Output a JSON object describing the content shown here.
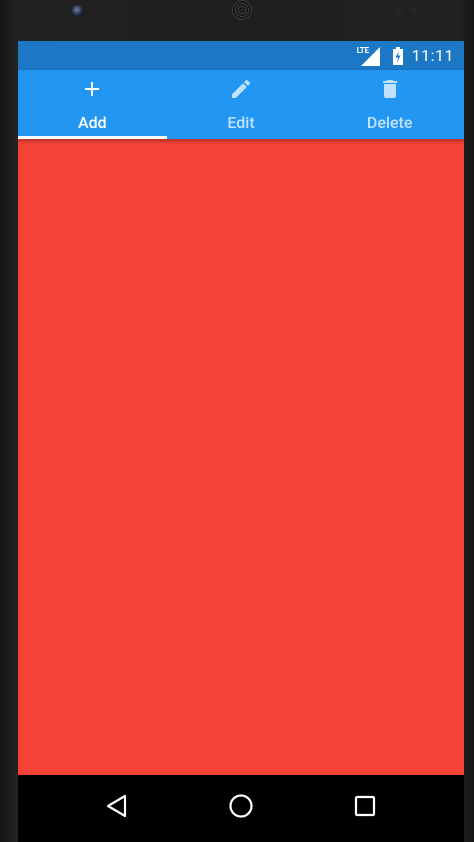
{
  "device": {
    "camera_icon": "camera-lens",
    "speaker_icon": "earpiece-grille"
  },
  "status_bar": {
    "network_label": "LTE",
    "signal_icon": "cellular-signal",
    "battery_icon": "battery-charging",
    "time": "11:11",
    "background_color": "#1c78c5"
  },
  "tabs": [
    {
      "label": "Add",
      "icon": "plus",
      "active": true
    },
    {
      "label": "Edit",
      "icon": "pencil",
      "active": false
    },
    {
      "label": "Delete",
      "icon": "trash",
      "active": false
    }
  ],
  "tab_bar_color": "#2196f3",
  "content": {
    "background_color": "#f44336"
  },
  "navigation_bar": {
    "back_icon": "triangle-back",
    "home_icon": "circle-home",
    "recents_icon": "square-overview"
  }
}
